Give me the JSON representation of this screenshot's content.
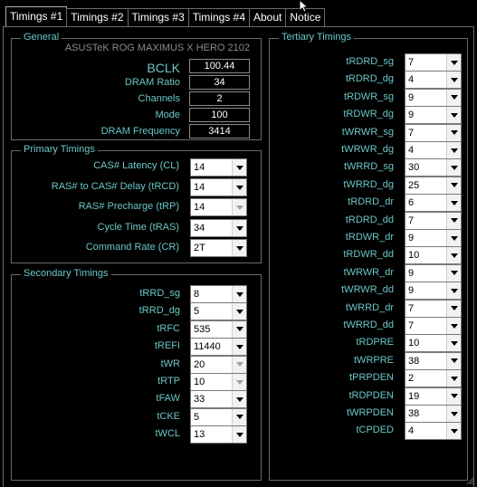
{
  "tabs": [
    "Timings #1",
    "Timings #2",
    "Timings #3",
    "Timings #4",
    "About",
    "Notice"
  ],
  "general": {
    "title": "General",
    "board": "ASUSTeK ROG MAXIMUS X HERO 2102",
    "bclk_label": "BCLK",
    "bclk": "100.44",
    "ratio_label": "DRAM Ratio",
    "ratio": "34",
    "channels_label": "Channels",
    "channels": "2",
    "mode_label": "Mode",
    "mode": "100",
    "freq_label": "DRAM Frequency",
    "freq": "3414"
  },
  "primary": {
    "title": "Primary Timings",
    "rows": [
      {
        "label": "CAS# Latency (CL)",
        "value": "14"
      },
      {
        "label": "RAS# to CAS# Delay (tRCD)",
        "value": "14"
      },
      {
        "label": "RAS# Precharge (tRP)",
        "value": "14"
      },
      {
        "label": "Cycle Time (tRAS)",
        "value": "34"
      },
      {
        "label": "Command Rate (CR)",
        "value": "2T"
      }
    ]
  },
  "secondary": {
    "title": "Secondary Timings",
    "rows": [
      {
        "label": "tRRD_sg",
        "value": "8"
      },
      {
        "label": "tRRD_dg",
        "value": "5"
      },
      {
        "label": "tRFC",
        "value": "535"
      },
      {
        "label": "tREFI",
        "value": "11440"
      },
      {
        "label": "tWR",
        "value": "20"
      },
      {
        "label": "tRTP",
        "value": "10"
      },
      {
        "label": "tFAW",
        "value": "33"
      },
      {
        "label": "tCKE",
        "value": "5"
      },
      {
        "label": "tWCL",
        "value": "13"
      }
    ]
  },
  "tertiary": {
    "title": "Tertiary Timings",
    "rows": [
      {
        "label": "tRDRD_sg",
        "value": "7"
      },
      {
        "label": "tRDRD_dg",
        "value": "4"
      },
      {
        "label": "tRDWR_sg",
        "value": "9"
      },
      {
        "label": "tRDWR_dg",
        "value": "9"
      },
      {
        "label": "tWRWR_sg",
        "value": "7"
      },
      {
        "label": "tWRWR_dg",
        "value": "4"
      },
      {
        "label": "tWRRD_sg",
        "value": "30"
      },
      {
        "label": "tWRRD_dg",
        "value": "25"
      },
      {
        "label": "tRDRD_dr",
        "value": "6"
      },
      {
        "label": "tRDRD_dd",
        "value": "7"
      },
      {
        "label": "tRDWR_dr",
        "value": "9"
      },
      {
        "label": "tRDWR_dd",
        "value": "10"
      },
      {
        "label": "tWRWR_dr",
        "value": "9"
      },
      {
        "label": "tWRWR_dd",
        "value": "9"
      },
      {
        "label": "tWRRD_dr",
        "value": "7"
      },
      {
        "label": "tWRRD_dd",
        "value": "7"
      },
      {
        "label": "tRDPRE",
        "value": "10"
      },
      {
        "label": "tWRPRE",
        "value": "38"
      },
      {
        "label": "tPRPDEN",
        "value": "2"
      },
      {
        "label": "tRDPDEN",
        "value": "19"
      },
      {
        "label": "tWRPDEN",
        "value": "38"
      },
      {
        "label": "tCPDED",
        "value": "4"
      }
    ]
  }
}
